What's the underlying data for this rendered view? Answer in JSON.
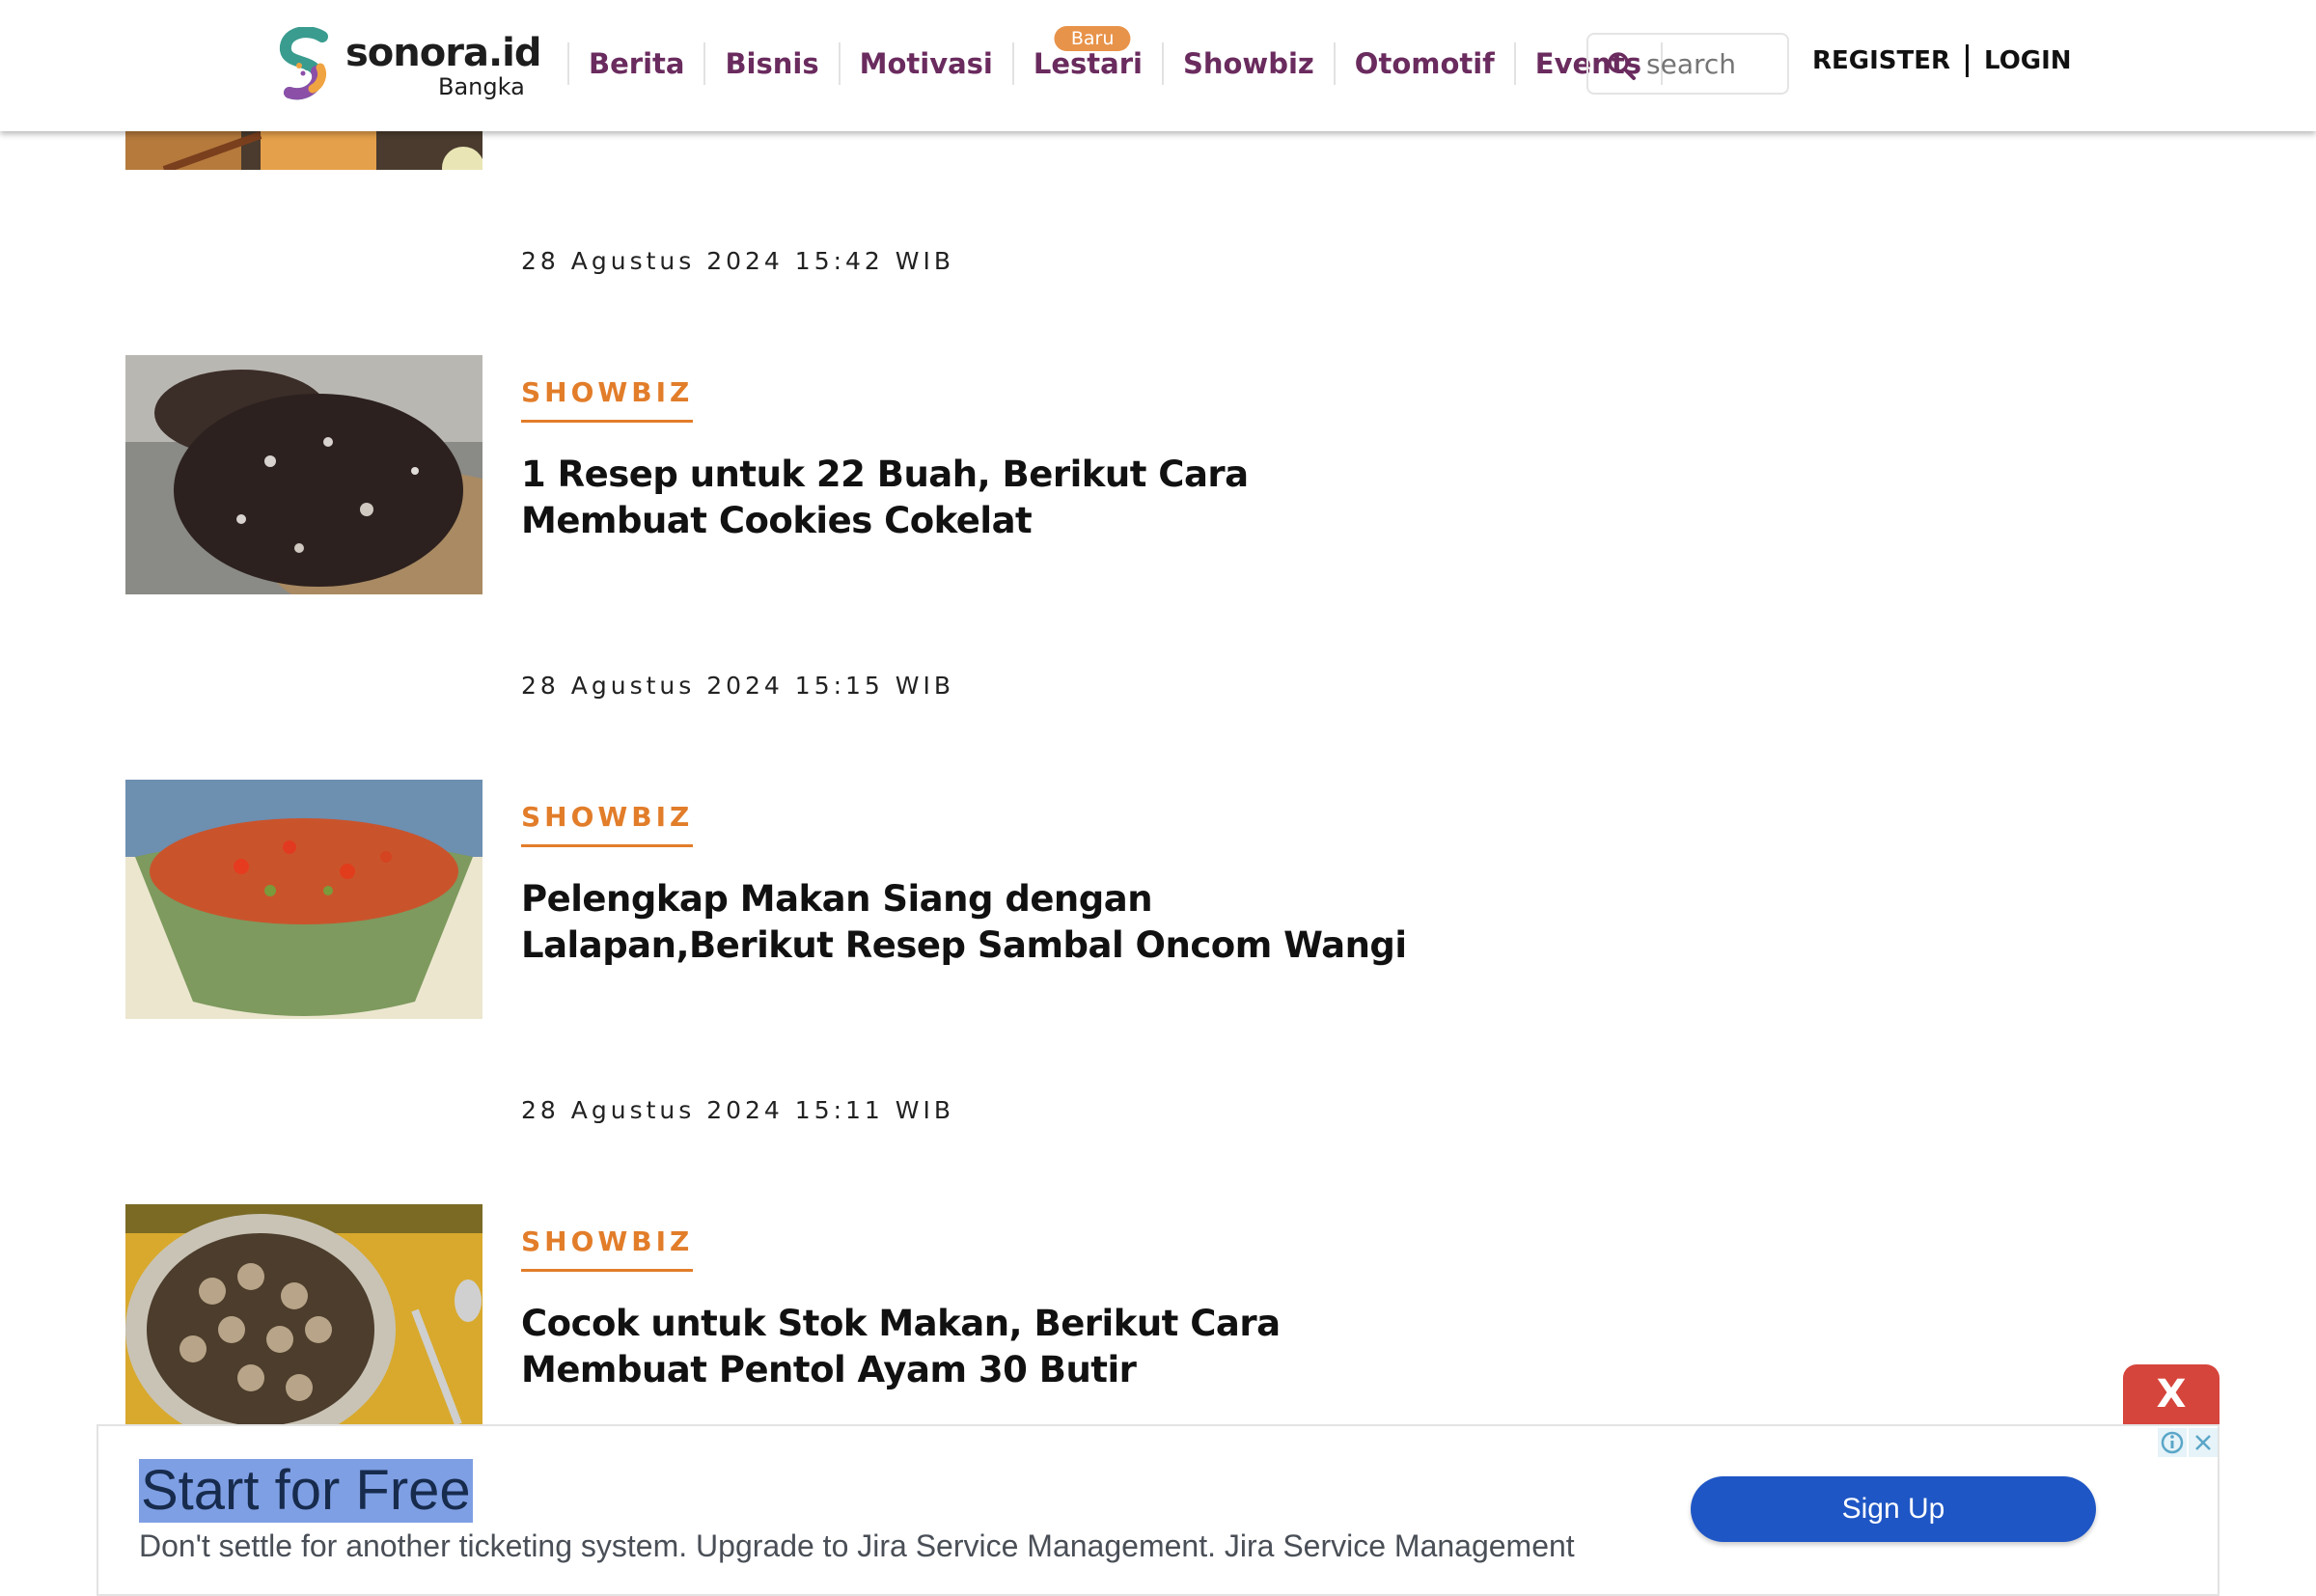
{
  "brand": {
    "name": "sonora.id",
    "region": "Bangka"
  },
  "nav": [
    {
      "label": "Berita"
    },
    {
      "label": "Bisnis"
    },
    {
      "label": "Motivasi"
    },
    {
      "label": "Lestari",
      "badge": "Baru"
    },
    {
      "label": "Showbiz"
    },
    {
      "label": "Otomotif"
    },
    {
      "label": "Events"
    }
  ],
  "search": {
    "placeholder": "search"
  },
  "auth": {
    "register": "REGISTER",
    "login": "LOGIN"
  },
  "articles": [
    {
      "date": "28 Agustus 2024 15:42 WIB"
    },
    {
      "category": "SHOWBIZ",
      "title": "1 Resep untuk 22 Buah, Berikut Cara Membuat Cookies Cokelat",
      "date": "28 Agustus 2024 15:15 WIB"
    },
    {
      "category": "SHOWBIZ",
      "title": "Pelengkap Makan Siang dengan Lalapan,Berikut Resep Sambal Oncom Wangi",
      "date": "28 Agustus 2024 15:11 WIB"
    },
    {
      "category": "SHOWBIZ",
      "title": "Cocok untuk Stok Makan, Berikut Cara Membuat Pentol Ayam 30 Butir"
    }
  ],
  "ad": {
    "close_label": "X",
    "headline": "Start for Free",
    "body": "Don't settle for another ticketing system. Upgrade to Jira Service Management. Jira Service Management",
    "cta": "Sign Up"
  },
  "colors": {
    "nav": "#6a2b5e",
    "category": "#e27d2a",
    "badge": "#e8934a",
    "cta": "#1f56c5",
    "ad_close": "#d6453c"
  }
}
